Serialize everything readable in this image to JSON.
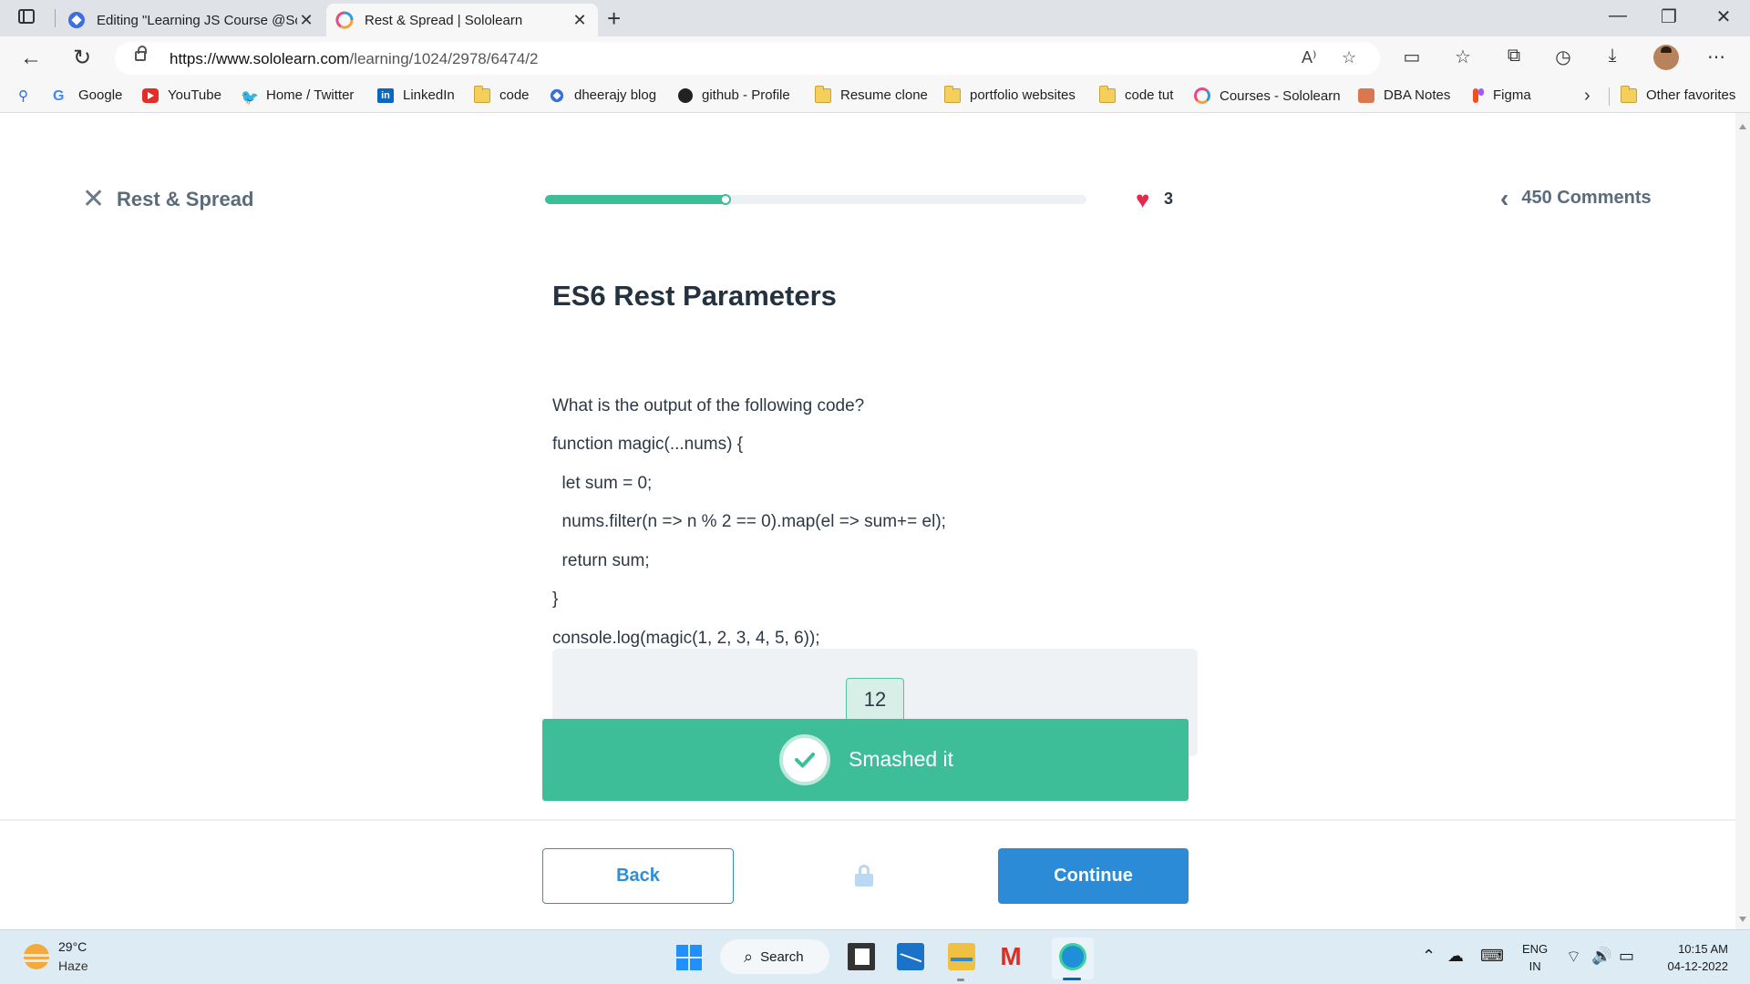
{
  "browser": {
    "tabs": [
      {
        "title": "Editing \"Learning JS Course @Sc",
        "active": false,
        "icon": "blue-diamond-icon"
      },
      {
        "title": "Rest & Spread | Sololearn",
        "active": true,
        "icon": "sololearn-icon"
      }
    ],
    "url": {
      "host": "https://www.sololearn.com",
      "path": "/learning/1024/2978/6474/2"
    },
    "bookmarks": [
      {
        "label": "Google",
        "icon": "google-icon"
      },
      {
        "label": "YouTube",
        "icon": "youtube-icon"
      },
      {
        "label": "Home / Twitter",
        "icon": "twitter-icon"
      },
      {
        "label": "LinkedIn",
        "icon": "linkedin-icon"
      },
      {
        "label": "code",
        "icon": "folder-icon"
      },
      {
        "label": "dheerajy blog",
        "icon": "blue-diamond-icon"
      },
      {
        "label": "github - Profile",
        "icon": "github-icon"
      },
      {
        "label": "Resume clone",
        "icon": "folder-icon"
      },
      {
        "label": "portfolio websites",
        "icon": "folder-icon"
      },
      {
        "label": "code tut",
        "icon": "folder-icon"
      },
      {
        "label": "Courses - Sololearn",
        "icon": "sololearn-icon"
      },
      {
        "label": "DBA Notes",
        "icon": "notes-icon"
      },
      {
        "label": "Figma",
        "icon": "figma-icon"
      }
    ],
    "other_favorites": "Other favorites"
  },
  "lesson": {
    "title": "Rest & Spread",
    "progress": 0.34,
    "lives": "3",
    "comments": "450 Comments"
  },
  "question": {
    "heading": "ES6 Rest Parameters",
    "lines": [
      "What is the output of the following code?",
      "function magic(...nums) {",
      "  let sum = 0;",
      "  nums.filter(n => n % 2 == 0).map(el => sum+= el);",
      "  return sum;",
      "}",
      "console.log(magic(1, 2, 3, 4, 5, 6));"
    ],
    "answer": "12",
    "result": "Smashed it"
  },
  "actions": {
    "back": "Back",
    "continue": "Continue"
  },
  "taskbar": {
    "temperature": "29°C",
    "condition": "Haze",
    "search": "Search",
    "lang_top": "ENG",
    "lang_bottom": "IN",
    "time": "10:15 AM",
    "date": "04-12-2022"
  },
  "colors": {
    "accent_green": "#3dbd98",
    "accent_blue": "#2b8bd6",
    "heart_red": "#e5284e"
  }
}
